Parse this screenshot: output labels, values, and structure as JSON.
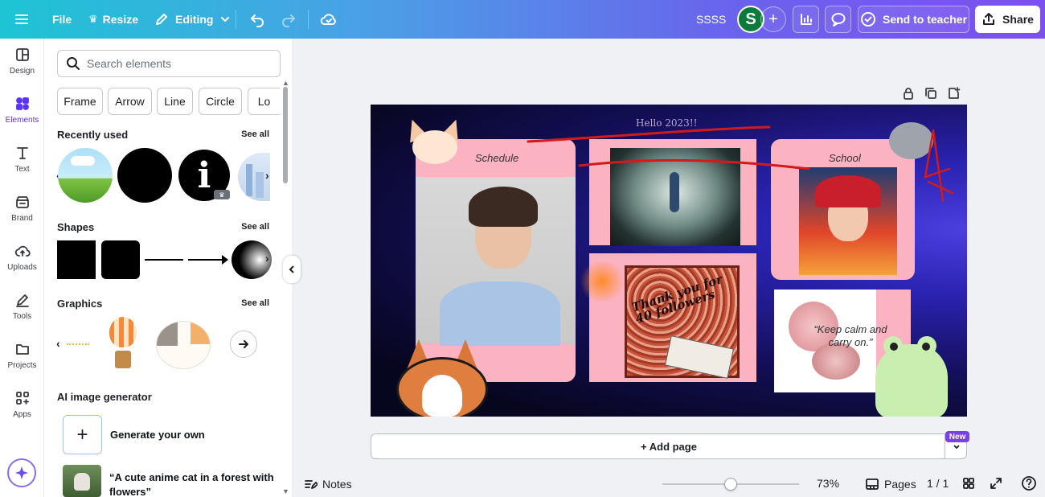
{
  "topbar": {
    "file_label": "File",
    "resize_label": "Resize",
    "editing_label": "Editing",
    "doc_title": "SSSS",
    "avatar_letter": "S",
    "send_label": "Send to teacher",
    "share_label": "Share"
  },
  "rail": {
    "items": [
      {
        "label": "Design",
        "icon": "layout-icon"
      },
      {
        "label": "Elements",
        "icon": "shapes-icon"
      },
      {
        "label": "Text",
        "icon": "text-icon"
      },
      {
        "label": "Brand",
        "icon": "brand-icon"
      },
      {
        "label": "Uploads",
        "icon": "cloud-upload-icon"
      },
      {
        "label": "Tools",
        "icon": "pencil-icon"
      },
      {
        "label": "Projects",
        "icon": "folder-icon"
      },
      {
        "label": "Apps",
        "icon": "apps-grid-icon"
      }
    ]
  },
  "panel": {
    "search_placeholder": "Search elements",
    "chips": [
      "Frame",
      "Arrow",
      "Line",
      "Circle",
      "Lo"
    ],
    "recently_used": "Recently used",
    "shapes": "Shapes",
    "graphics": "Graphics",
    "see_all": "See all",
    "ai_title": "AI image generator",
    "generate_label": "Generate your own",
    "prompt_example": "“A cute anime cat in a forest with flowers”"
  },
  "canvas": {
    "hello": "Hello 2023!!",
    "schedule": "Schedule",
    "school": "School",
    "thanks_text": "Thank you for 40 followers",
    "quote": "“Keep calm and carry on.”"
  },
  "bottom": {
    "add_page": "+ Add page",
    "new_badge": "New",
    "notes": "Notes",
    "zoom": "73%",
    "pages": "Pages",
    "page_counter": "1 / 1",
    "zoom_level": 0.5
  },
  "colors": {
    "accent": "#5a32fa",
    "card_pink": "#fbb2c1",
    "avatar_green": "#0b7a3b"
  }
}
